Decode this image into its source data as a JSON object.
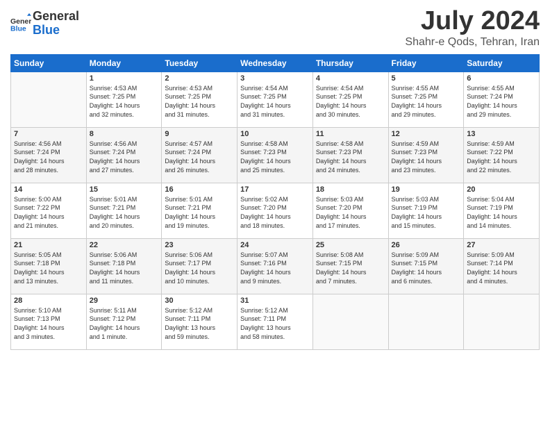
{
  "header": {
    "logo_text_general": "General",
    "logo_text_blue": "Blue",
    "month_year": "July 2024",
    "location": "Shahr-e Qods, Tehran, Iran"
  },
  "calendar": {
    "days_of_week": [
      "Sunday",
      "Monday",
      "Tuesday",
      "Wednesday",
      "Thursday",
      "Friday",
      "Saturday"
    ],
    "weeks": [
      [
        {
          "day": "",
          "info": ""
        },
        {
          "day": "1",
          "info": "Sunrise: 4:53 AM\nSunset: 7:25 PM\nDaylight: 14 hours\nand 32 minutes."
        },
        {
          "day": "2",
          "info": "Sunrise: 4:53 AM\nSunset: 7:25 PM\nDaylight: 14 hours\nand 31 minutes."
        },
        {
          "day": "3",
          "info": "Sunrise: 4:54 AM\nSunset: 7:25 PM\nDaylight: 14 hours\nand 31 minutes."
        },
        {
          "day": "4",
          "info": "Sunrise: 4:54 AM\nSunset: 7:25 PM\nDaylight: 14 hours\nand 30 minutes."
        },
        {
          "day": "5",
          "info": "Sunrise: 4:55 AM\nSunset: 7:25 PM\nDaylight: 14 hours\nand 29 minutes."
        },
        {
          "day": "6",
          "info": "Sunrise: 4:55 AM\nSunset: 7:24 PM\nDaylight: 14 hours\nand 29 minutes."
        }
      ],
      [
        {
          "day": "7",
          "info": "Sunrise: 4:56 AM\nSunset: 7:24 PM\nDaylight: 14 hours\nand 28 minutes."
        },
        {
          "day": "8",
          "info": "Sunrise: 4:56 AM\nSunset: 7:24 PM\nDaylight: 14 hours\nand 27 minutes."
        },
        {
          "day": "9",
          "info": "Sunrise: 4:57 AM\nSunset: 7:24 PM\nDaylight: 14 hours\nand 26 minutes."
        },
        {
          "day": "10",
          "info": "Sunrise: 4:58 AM\nSunset: 7:23 PM\nDaylight: 14 hours\nand 25 minutes."
        },
        {
          "day": "11",
          "info": "Sunrise: 4:58 AM\nSunset: 7:23 PM\nDaylight: 14 hours\nand 24 minutes."
        },
        {
          "day": "12",
          "info": "Sunrise: 4:59 AM\nSunset: 7:23 PM\nDaylight: 14 hours\nand 23 minutes."
        },
        {
          "day": "13",
          "info": "Sunrise: 4:59 AM\nSunset: 7:22 PM\nDaylight: 14 hours\nand 22 minutes."
        }
      ],
      [
        {
          "day": "14",
          "info": "Sunrise: 5:00 AM\nSunset: 7:22 PM\nDaylight: 14 hours\nand 21 minutes."
        },
        {
          "day": "15",
          "info": "Sunrise: 5:01 AM\nSunset: 7:21 PM\nDaylight: 14 hours\nand 20 minutes."
        },
        {
          "day": "16",
          "info": "Sunrise: 5:01 AM\nSunset: 7:21 PM\nDaylight: 14 hours\nand 19 minutes."
        },
        {
          "day": "17",
          "info": "Sunrise: 5:02 AM\nSunset: 7:20 PM\nDaylight: 14 hours\nand 18 minutes."
        },
        {
          "day": "18",
          "info": "Sunrise: 5:03 AM\nSunset: 7:20 PM\nDaylight: 14 hours\nand 17 minutes."
        },
        {
          "day": "19",
          "info": "Sunrise: 5:03 AM\nSunset: 7:19 PM\nDaylight: 14 hours\nand 15 minutes."
        },
        {
          "day": "20",
          "info": "Sunrise: 5:04 AM\nSunset: 7:19 PM\nDaylight: 14 hours\nand 14 minutes."
        }
      ],
      [
        {
          "day": "21",
          "info": "Sunrise: 5:05 AM\nSunset: 7:18 PM\nDaylight: 14 hours\nand 13 minutes."
        },
        {
          "day": "22",
          "info": "Sunrise: 5:06 AM\nSunset: 7:18 PM\nDaylight: 14 hours\nand 11 minutes."
        },
        {
          "day": "23",
          "info": "Sunrise: 5:06 AM\nSunset: 7:17 PM\nDaylight: 14 hours\nand 10 minutes."
        },
        {
          "day": "24",
          "info": "Sunrise: 5:07 AM\nSunset: 7:16 PM\nDaylight: 14 hours\nand 9 minutes."
        },
        {
          "day": "25",
          "info": "Sunrise: 5:08 AM\nSunset: 7:15 PM\nDaylight: 14 hours\nand 7 minutes."
        },
        {
          "day": "26",
          "info": "Sunrise: 5:09 AM\nSunset: 7:15 PM\nDaylight: 14 hours\nand 6 minutes."
        },
        {
          "day": "27",
          "info": "Sunrise: 5:09 AM\nSunset: 7:14 PM\nDaylight: 14 hours\nand 4 minutes."
        }
      ],
      [
        {
          "day": "28",
          "info": "Sunrise: 5:10 AM\nSunset: 7:13 PM\nDaylight: 14 hours\nand 3 minutes."
        },
        {
          "day": "29",
          "info": "Sunrise: 5:11 AM\nSunset: 7:12 PM\nDaylight: 14 hours\nand 1 minute."
        },
        {
          "day": "30",
          "info": "Sunrise: 5:12 AM\nSunset: 7:11 PM\nDaylight: 13 hours\nand 59 minutes."
        },
        {
          "day": "31",
          "info": "Sunrise: 5:12 AM\nSunset: 7:11 PM\nDaylight: 13 hours\nand 58 minutes."
        },
        {
          "day": "",
          "info": ""
        },
        {
          "day": "",
          "info": ""
        },
        {
          "day": "",
          "info": ""
        }
      ]
    ]
  }
}
